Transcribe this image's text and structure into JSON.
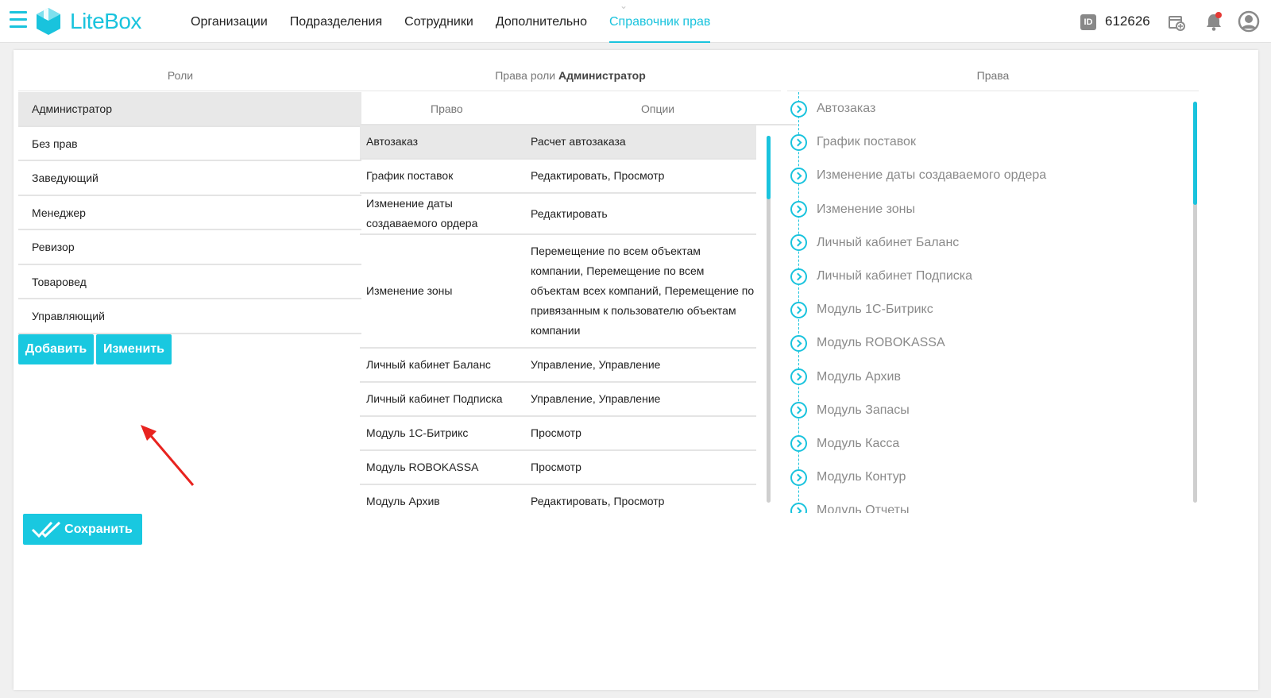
{
  "app": {
    "logo_text": "LiteBox",
    "brand_color": "#19c3dd"
  },
  "nav": {
    "items": [
      {
        "label": "Организации"
      },
      {
        "label": "Подразделения"
      },
      {
        "label": "Сотрудники"
      },
      {
        "label": "Дополнительно"
      },
      {
        "label": "Справочник прав",
        "active": true
      }
    ]
  },
  "account": {
    "id_badge": "ID",
    "id_value": "612626",
    "notification_dot_color": "#e53935"
  },
  "roles": {
    "title": "Роли",
    "items": [
      "Администратор",
      "Без прав",
      "Заведующий",
      "Менеджер",
      "Ревизор",
      "Товаровед",
      "Управляющий"
    ],
    "selected": "Администратор",
    "add_label": "Добавить",
    "edit_label": "Изменить"
  },
  "role_rights": {
    "title_prefix": "Права роли",
    "title_role": "Администратор",
    "col_right": "Право",
    "col_options": "Опции",
    "rows": [
      {
        "right": "Автозаказ",
        "options": "Расчет автозаказа"
      },
      {
        "right": "График поставок",
        "options": "Редактировать, Просмотр"
      },
      {
        "right": "Изменение даты создаваемого ордера",
        "options": "Редактировать"
      },
      {
        "right": "Изменение зоны",
        "options": "Перемещение по всем объектам компании, Перемещение по всем объектам всех компаний, Перемещение по привязанным к пользователю объектам компании"
      },
      {
        "right": "Личный кабинет Баланс",
        "options": "Управление, Управление"
      },
      {
        "right": "Личный кабинет Подписка",
        "options": "Управление, Управление"
      },
      {
        "right": "Модуль 1С-Битрикс",
        "options": "Просмотр"
      },
      {
        "right": "Модуль ROBOKASSA",
        "options": "Просмотр"
      },
      {
        "right": "Модуль Архив",
        "options": "Редактировать, Просмотр"
      }
    ]
  },
  "rights": {
    "title": "Права",
    "items": [
      "Автозаказ",
      "График поставок",
      "Изменение даты создаваемого ордера",
      "Изменение зоны",
      "Личный кабинет Баланс",
      "Личный кабинет Подписка",
      "Модуль 1С-Битрикс",
      "Модуль ROBOKASSA",
      "Модуль Архив",
      "Модуль Запасы",
      "Модуль Касса",
      "Модуль Контур",
      "Модуль Отчеты"
    ]
  },
  "save_label": "Сохранить",
  "annotation_arrow_color": "#e8231f"
}
